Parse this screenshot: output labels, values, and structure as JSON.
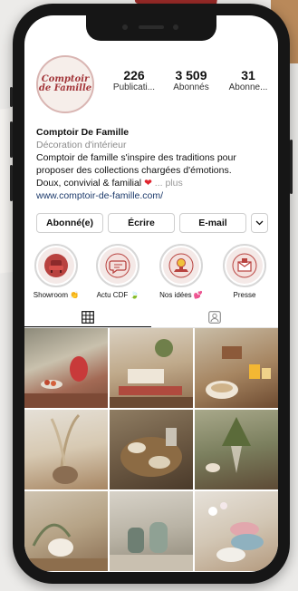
{
  "profile": {
    "avatar_text": "Comptoir de Famille",
    "stats": [
      {
        "value": "226",
        "label": "Publicati..."
      },
      {
        "value": "3 509",
        "label": "Abonnés"
      },
      {
        "value": "31",
        "label": "Abonne..."
      }
    ],
    "name": "Comptoir De Famille",
    "category": "Décoration d'intérieur",
    "bio_line1": "Comptoir de famille s'inspire des traditions pour proposer des collections chargées d'émotions.",
    "bio_line2": "Doux, convivial & familial",
    "heart": "❤",
    "more": "... plus",
    "link": "www.comptoir-de-famille.com/"
  },
  "actions": {
    "follow_label": "Abonné(e)",
    "message_label": "Écrire",
    "email_label": "E-mail",
    "more_chevron": "⌄"
  },
  "highlights": [
    {
      "label": "Showroom 👏",
      "icon": "armchair-icon"
    },
    {
      "label": "Actu CDF 🍃",
      "icon": "speech-bubble-icon"
    },
    {
      "label": "Nos idées 💕",
      "icon": "lightbulb-icon"
    },
    {
      "label": "Presse",
      "icon": "envelope-icon"
    }
  ],
  "tabs": {
    "grid_icon": "grid-icon",
    "tagged_icon": "tagged-person-icon"
  },
  "colors": {
    "brand_red": "#a3363a",
    "link_blue": "#1c3a6b",
    "heart_red": "#e0252f"
  }
}
